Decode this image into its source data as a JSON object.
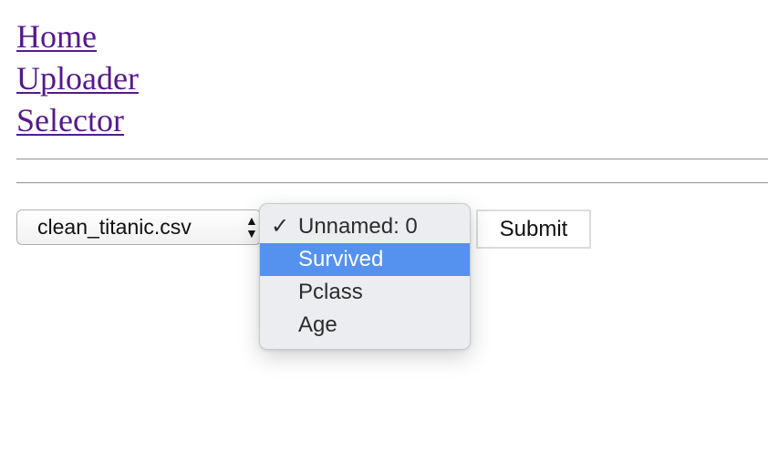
{
  "nav": {
    "links": [
      "Home",
      "Uploader",
      "Selector"
    ]
  },
  "file_select": {
    "value": "clean_titanic.csv",
    "arrows_icon": "up-down-arrows-icon"
  },
  "column_menu": {
    "check_mark": "✓",
    "checked_item": "Unnamed: 0",
    "highlighted_item": "Survived",
    "items": [
      "Unnamed: 0",
      "Survived",
      "Pclass",
      "Age"
    ]
  },
  "submit": {
    "label": "Submit"
  },
  "colors": {
    "link": "#551a8b",
    "highlight": "#5592ef",
    "menu_background": "#ecedf0"
  }
}
